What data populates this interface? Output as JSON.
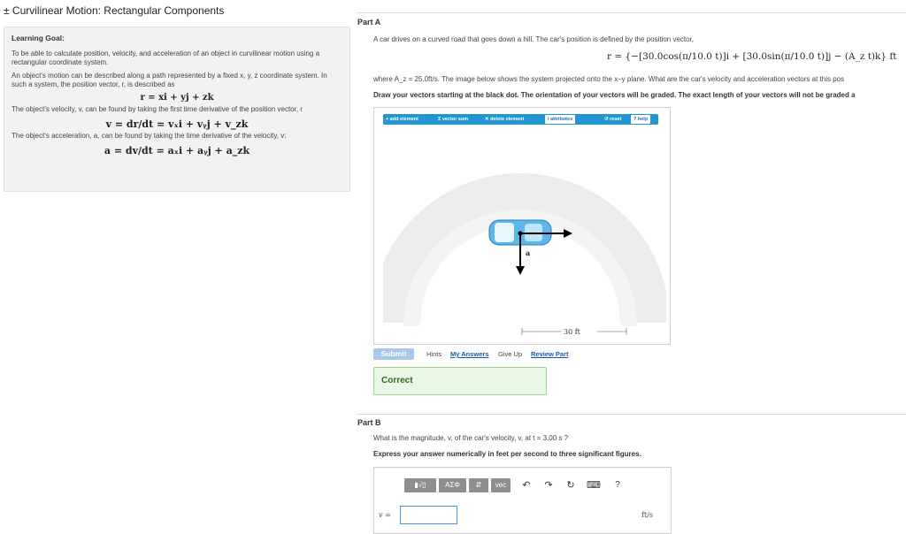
{
  "page_title": "± Curvilinear Motion: Rectangular Components",
  "goal": {
    "heading": "Learning Goal:",
    "p1": "To be able to calculate position, velocity, and acceleration of an object in curvilinear motion using a rectangular coordinate system.",
    "p2": "An object's motion can be described along a path represented by a fixed x, y, z coordinate system. In such a system, the position vector, r, is described as",
    "eq_r": "r = xi + yj + zk",
    "p3": "The object's velocity, v, can be found by taking the first time derivative of the position vector, r",
    "eq_v": "v = dr/dt = vₓi + vᵧj + v_zk",
    "p4": "The object's acceleration, a, can be found by taking the time derivative of the velocity, v:",
    "eq_a": "a = dv/dt = aₓi + aᵧj + a_zk"
  },
  "partA": {
    "label": "Part A",
    "intro": "A car drives on a curved road that goes down a hill. The car's position is defined by the position vector,",
    "formula": "r = {−[30.0cos(π/10.0 t)]i + [30.0sin(π/10.0 t)]j − (A_z t)k} ft",
    "where": "where A_z = 25.0ft/s. The image below shows the system projected onto the x–y plane. What are the car's velocity and acceleration vectors at this pos",
    "instruction": "Draw your vectors starting at the black dot. The orientation of your vectors will be graded. The exact length of your vectors will not be graded a",
    "toolbar": {
      "add_element": "add element",
      "vector_sum": "vector sum",
      "delete_element": "delete element",
      "attributes": "attributes",
      "reset": "reset",
      "help": "help"
    },
    "vector_label": "a",
    "dimension": "30 ft",
    "submit": "Submit",
    "hints": "Hints",
    "my_answers": "My Answers",
    "give_up": "Give Up",
    "review_part": "Review Part",
    "result": "Correct"
  },
  "partB": {
    "label": "Part B",
    "question": "What is the magnitude, v, of the car's velocity, v, at t = 3.00 s ?",
    "instruction": "Express your answer numerically in feet per second to three significant figures.",
    "toolbar": {
      "templates": "▮√▯",
      "greek": "ΑΣΦ",
      "sort": "⇵",
      "vec": "vec",
      "help": "?"
    },
    "var_label": "v =",
    "value": "",
    "unit": "ft/s"
  }
}
